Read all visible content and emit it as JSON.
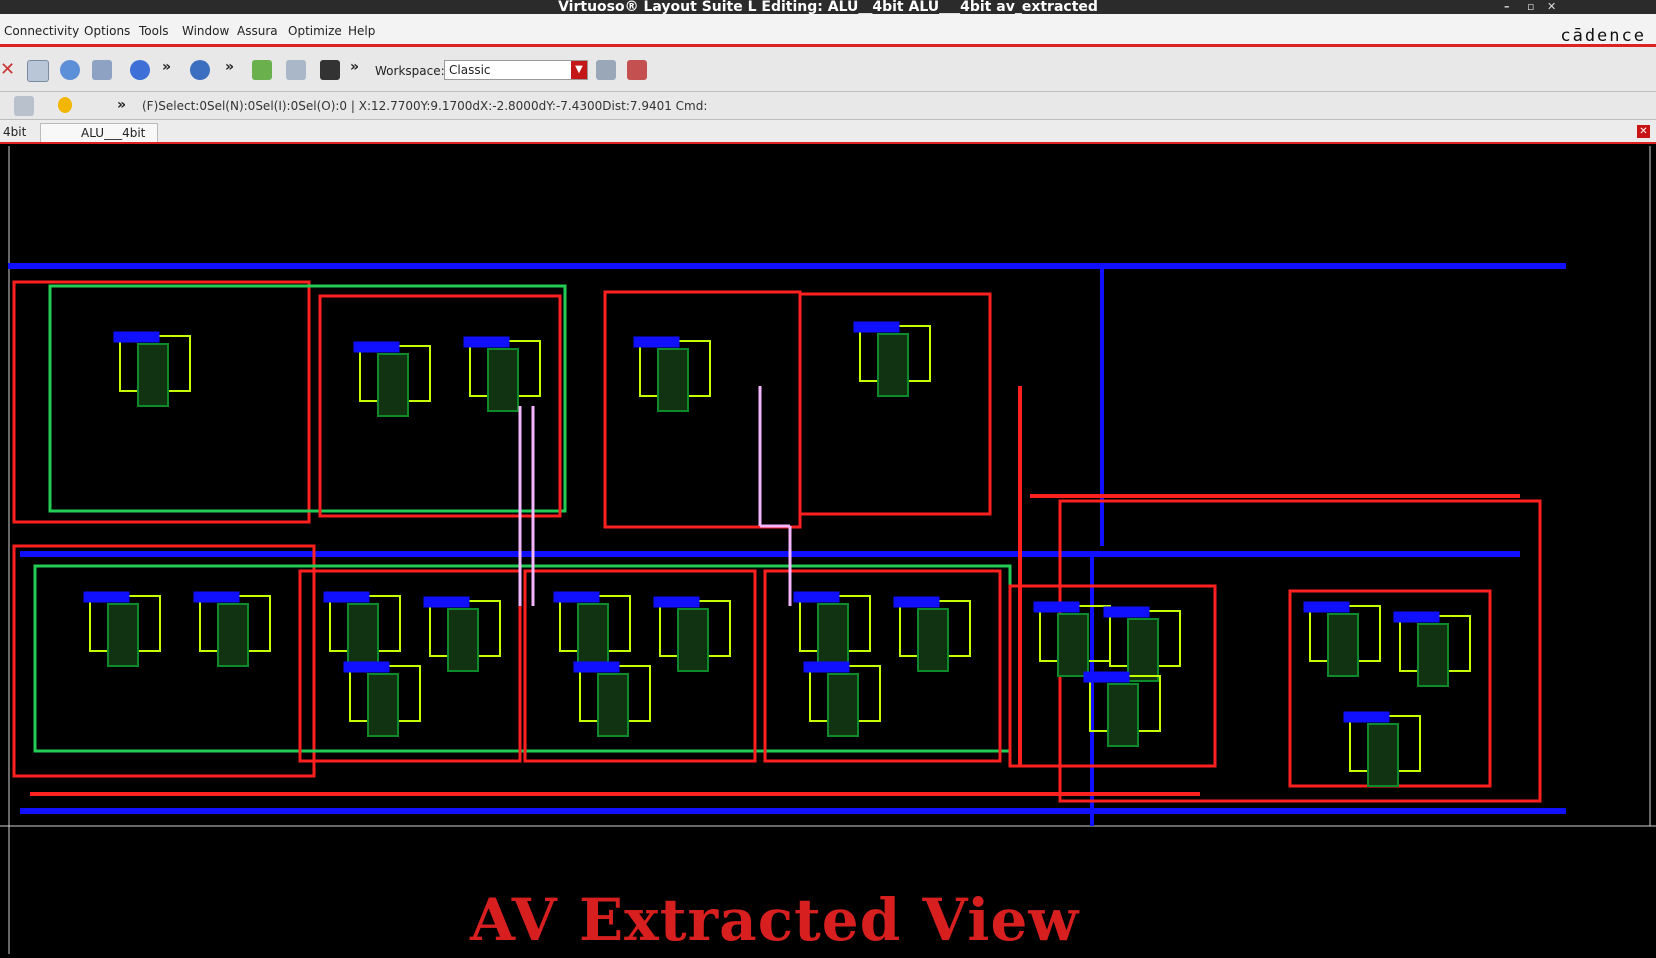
{
  "window": {
    "title": "Virtuoso® Layout Suite L Editing: ALU__4bit ALU___4bit av_extracted",
    "controls": [
      "–",
      "▫",
      "✕"
    ]
  },
  "menubar": {
    "items": [
      "Connectivity",
      "Options",
      "Tools",
      "Window",
      "Assura",
      "Optimize",
      "Help"
    ],
    "brand": "cādence"
  },
  "toolbar": {
    "more": "»",
    "workspace_label": "Workspace:",
    "workspace_value": "Classic"
  },
  "statusbar": {
    "more": "»",
    "text": "(F)Select:0Sel(N):0Sel(I):0Sel(O):0 | X:12.7700Y:9.1700dX:-2.8000dY:-7.4300Dist:7.9401 Cmd:"
  },
  "tabs": {
    "items": [
      "4bit",
      "ALU___4bit"
    ],
    "close": "✕"
  },
  "canvas": {
    "caption": "AV Extracted View",
    "colors": {
      "metal1": "#1010ff",
      "poly": "#ff1a1a",
      "nwell": "#22cc55",
      "active": "#c6ff00",
      "label": "#ffb000",
      "via": "#ffffff"
    }
  },
  "icons": [
    "close-icon",
    "library-icon",
    "info-icon",
    "align-icon",
    "refresh-icon",
    "zoom-icon",
    "create-instance-icon",
    "label-icon",
    "probe-icon",
    "workspace-save-icon",
    "workspace-load-icon",
    "select-filter-icon",
    "lightbulb-icon"
  ]
}
